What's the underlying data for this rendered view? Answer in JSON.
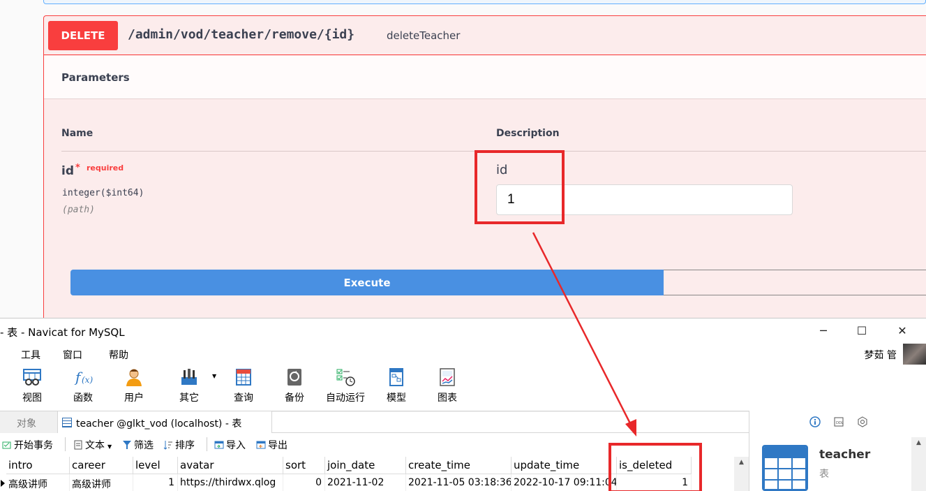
{
  "swagger": {
    "method": "DELETE",
    "path": "/admin/vod/teacher/remove/{id}",
    "operation": "deleteTeacher",
    "parameters_title": "Parameters",
    "col_name": "Name",
    "col_description": "Description",
    "param": {
      "name": "id",
      "star": "*",
      "required": "required",
      "type": "integer($int64)",
      "location": "(path)",
      "description": "id",
      "value": "1"
    },
    "execute_label": "Execute"
  },
  "navicat": {
    "title": "- 表 - Navicat for MySQL",
    "window_controls": [
      "─",
      "☐",
      "✕"
    ],
    "menu": [
      "工具",
      "窗口",
      "帮助"
    ],
    "user": "梦茹 管",
    "toolbar": [
      {
        "label": "视图",
        "icon": "view-icon"
      },
      {
        "label": "函数",
        "icon": "function-icon"
      },
      {
        "label": "用户",
        "icon": "user-icon"
      },
      {
        "label": "其它",
        "icon": "tools-icon"
      },
      {
        "label": "查询",
        "icon": "query-icon"
      },
      {
        "label": "备份",
        "icon": "backup-icon"
      },
      {
        "label": "自动运行",
        "icon": "schedule-icon"
      },
      {
        "label": "模型",
        "icon": "model-icon"
      },
      {
        "label": "图表",
        "icon": "chart-icon"
      }
    ],
    "tabs": {
      "objects": "对象",
      "current": "teacher @glkt_vod (localhost) - 表"
    },
    "subtoolbar": {
      "begin_transaction": "开始事务",
      "text": "文本",
      "filter": "筛选",
      "sort": "排序",
      "import": "导入",
      "export": "导出"
    },
    "grid": {
      "columns": [
        "intro",
        "career",
        "level",
        "avatar",
        "sort",
        "join_date",
        "create_time",
        "update_time",
        "is_deleted"
      ],
      "rows": [
        [
          "高级讲师",
          "高级讲师",
          "1",
          "https://thirdwx.qlog",
          "0",
          "2021-11-02",
          "2021-11-05 03:18:36",
          "2022-10-17 09:11:04",
          "1"
        ]
      ]
    },
    "info_panel": {
      "name": "teacher",
      "type": "表"
    }
  },
  "colors": {
    "delete": "#f93e3e",
    "execute": "#4990e2",
    "annotation": "#e8282a",
    "navicat_blue": "#2f78c4"
  }
}
